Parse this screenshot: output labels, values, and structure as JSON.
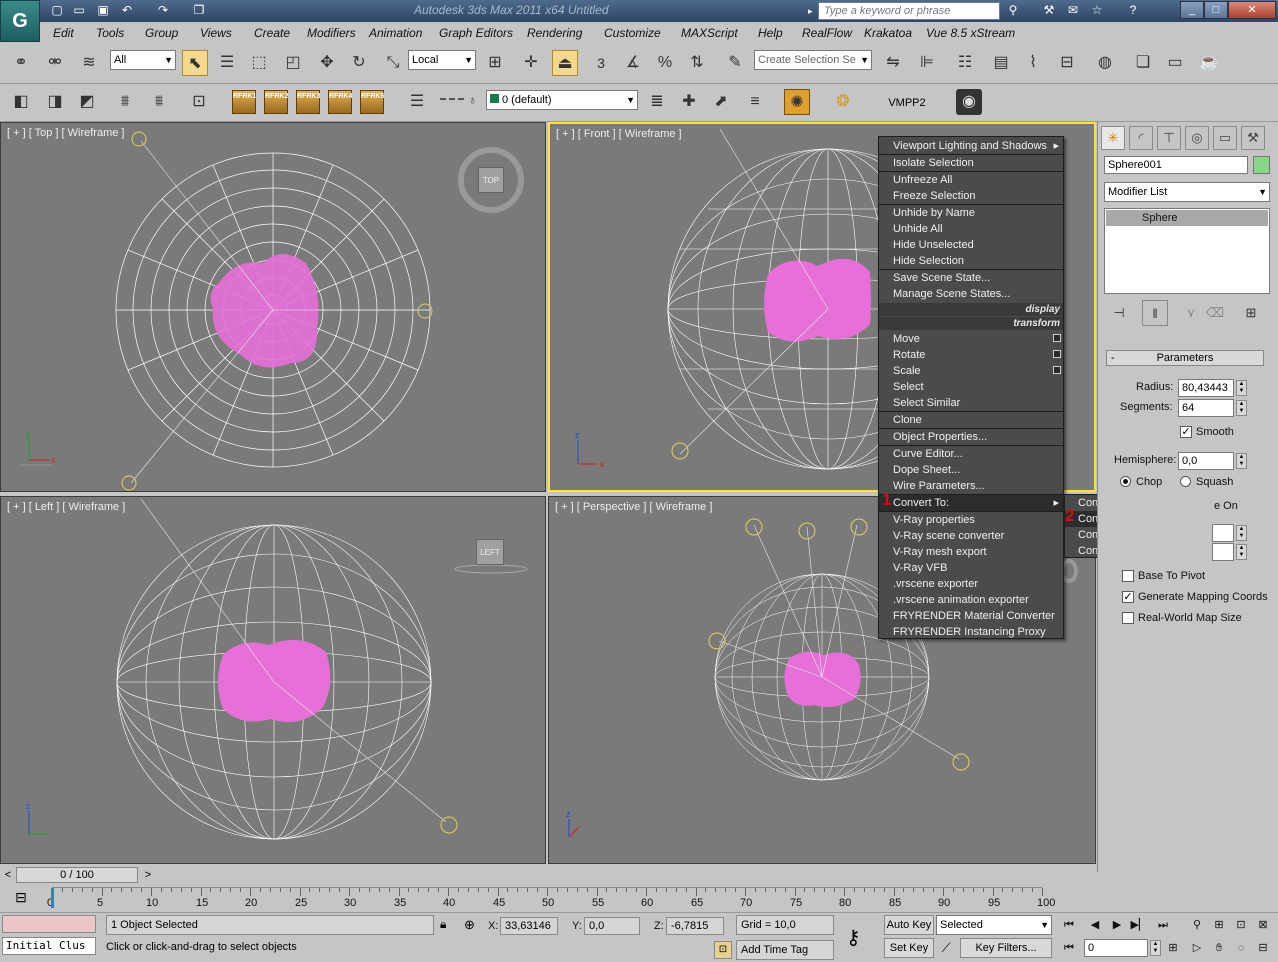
{
  "app": {
    "title": "Autodesk 3ds Max  2011 x64      Untitled",
    "search_placeholder": "Type a keyword or phrase"
  },
  "menubar": [
    "Edit",
    "Tools",
    "Group",
    "Views",
    "Create",
    "Modifiers",
    "Animation",
    "Graph Editors",
    "Rendering",
    "Customize",
    "MAXScript",
    "Help",
    "RealFlow",
    "Krakatoa",
    "Vue 8.5 xStream"
  ],
  "toolbar": {
    "selection_filter": "All",
    "ref_coord": "Local",
    "snap_number": "3",
    "named_selection": "Create Selection Se",
    "layer": "0 (default)",
    "vmpp": "VMPP2",
    "rf_labels": [
      "RFRK1",
      "RFRK2",
      "RFRK3",
      "RFRK4",
      "RFRK5"
    ]
  },
  "viewports": {
    "top": "[ + ] [ Top ] [ Wireframe ]",
    "front": "[ + ] [ Front ] [ Wireframe ]",
    "left": "[ + ] [ Left ] [ Wireframe ]",
    "perspective": "[ + ] [ Perspective ] [ Wireframe ]",
    "viewcube_top": "TOP",
    "viewcube_left": "LEFT"
  },
  "context_menu": {
    "items": [
      "Viewport Lighting and Shadows",
      "Isolate Selection",
      "Unfreeze All",
      "Freeze Selection",
      "Unhide by Name",
      "Unhide All",
      "Hide Unselected",
      "Hide Selection",
      "Save Scene State...",
      "Manage Scene States...",
      "Move",
      "Rotate",
      "Scale",
      "Select",
      "Select Similar",
      "Clone",
      "Object Properties...",
      "Curve Editor...",
      "Dope Sheet...",
      "Wire Parameters...",
      "Convert To:",
      "V-Ray properties",
      "V-Ray scene converter",
      "V-Ray mesh export",
      "V-Ray VFB",
      ".vrscene exporter",
      ".vrscene animation exporter",
      "FRYRENDER Material Converter",
      "FRYRENDER Instancing Proxy"
    ],
    "header_display": "display",
    "header_transform": "transform",
    "submenu": [
      "Convert to Editable Mesh",
      "Convert to Editable Poly",
      "Convert to Editable Patch",
      "Convert to NURBS"
    ],
    "marker1": "1",
    "marker2": "2"
  },
  "command_panel": {
    "object_name": "Sphere001",
    "object_color": "#88d888",
    "modifier_list": "Modifier List",
    "stack_item": "Sphere",
    "rollout": "Parameters",
    "radius_label": "Radius:",
    "radius": "80,43443",
    "segments_label": "Segments:",
    "segments": "64",
    "smooth_label": "Smooth",
    "smooth": true,
    "hemisphere_label": "Hemisphere:",
    "hemisphere": "0,0",
    "chop_label": "Chop",
    "squash_label": "Squash",
    "slice_on_fragment": "e On",
    "base_to_pivot": "Base To Pivot",
    "gen_mapping": "Generate Mapping Coords",
    "real_world": "Real-World Map Size"
  },
  "timeline": {
    "frame": "0 / 100",
    "ticks": [
      "0",
      "5",
      "10",
      "15",
      "20",
      "25",
      "30",
      "35",
      "40",
      "45",
      "50",
      "55",
      "60",
      "65",
      "70",
      "75",
      "80",
      "85",
      "90",
      "95",
      "100"
    ]
  },
  "status": {
    "maxscript": "Initial Clus",
    "selected": "1 Object Selected",
    "prompt": "Click or click-and-drag to select objects",
    "x_label": "X:",
    "x": "33,63146",
    "y_label": "Y:",
    "y": "0,0",
    "z_label": "Z:",
    "z": "-6,7815",
    "grid": "Grid = 10,0",
    "add_time_tag": "Add Time Tag",
    "auto_key": "Auto Key",
    "set_key": "Set Key",
    "key_mode": "Selected",
    "key_filters": "Key Filters...",
    "frame_field": "0"
  }
}
